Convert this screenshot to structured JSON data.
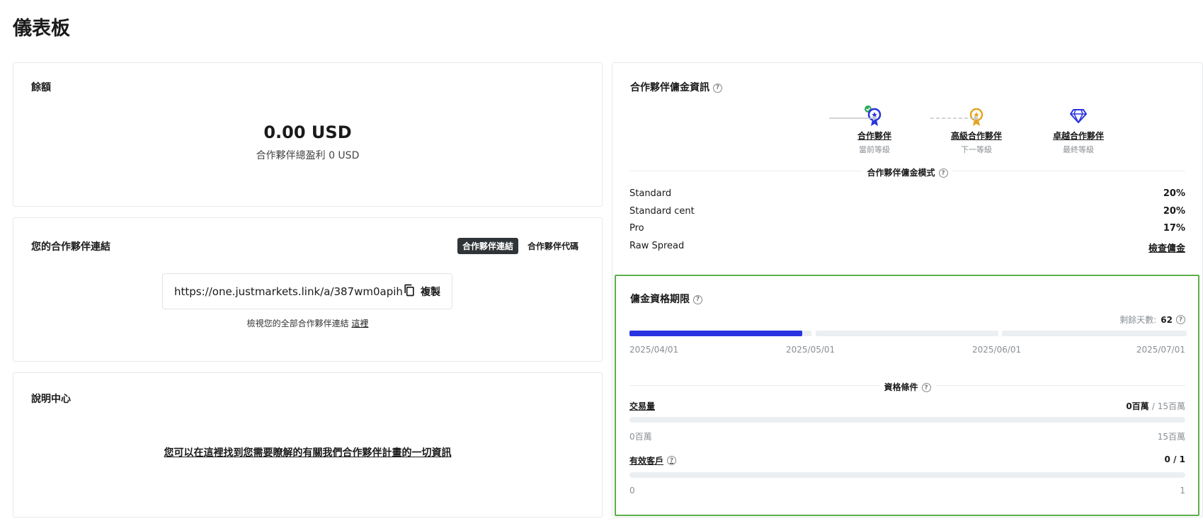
{
  "page": {
    "title": "儀表板"
  },
  "balance": {
    "title": "餘額",
    "amount": "0.00 USD",
    "subtitle": "合作夥伴總盈利 0 USD"
  },
  "partner_link": {
    "title": "您的合作夥伴連結",
    "tabs": [
      {
        "label": "合作夥伴連結",
        "active": true
      },
      {
        "label": "合作夥伴代碼",
        "active": false
      }
    ],
    "url": "https://one.justmarkets.link/a/387wm0apih",
    "copy_label": "複製",
    "note_text": "檢視您的全部合作夥伴連結",
    "note_link": "這裡"
  },
  "help": {
    "title": "說明中心",
    "link_text": "您可以在這裡找到您需要瞭解的有關我們合作夥伴計畫的一切資訊"
  },
  "commission": {
    "title": "合作夥伴傭金資訊",
    "tiers": [
      {
        "name": "合作夥伴",
        "level": "當前等級",
        "icon": "medal-icon",
        "color": "#2a33e0",
        "achieved": true
      },
      {
        "name": "高級合作夥伴",
        "level": "下一等級",
        "icon": "medal-icon",
        "color": "#e3a521",
        "achieved": false
      },
      {
        "name": "卓越合作夥伴",
        "level": "最終等級",
        "icon": "diamond-icon",
        "color": "#2a33e0",
        "achieved": false
      }
    ],
    "model_title": "合作夥伴傭金模式",
    "rates": [
      {
        "name": "Standard",
        "value": "20%"
      },
      {
        "name": "Standard cent",
        "value": "20%"
      },
      {
        "name": "Pro",
        "value": "17%"
      },
      {
        "name": "Raw Spread",
        "value": "檢查傭金"
      }
    ]
  },
  "qualification": {
    "title": "傭金資格期限",
    "remaining_label": "剩餘天數:",
    "remaining_days": "62",
    "period_progress": 0.95,
    "dates": [
      "2025/04/01",
      "2025/05/01",
      "2025/06/01",
      "2025/07/01"
    ],
    "conditions_title": "資格條件",
    "volume": {
      "label": "交易量",
      "current": "0百萬",
      "target": "15百萬",
      "min": "0百萬",
      "max": "15百萬",
      "progress": 0
    },
    "clients": {
      "label": "有效客戶",
      "current": "0",
      "target": "1",
      "min": "0",
      "max": "1",
      "progress": 0
    }
  }
}
